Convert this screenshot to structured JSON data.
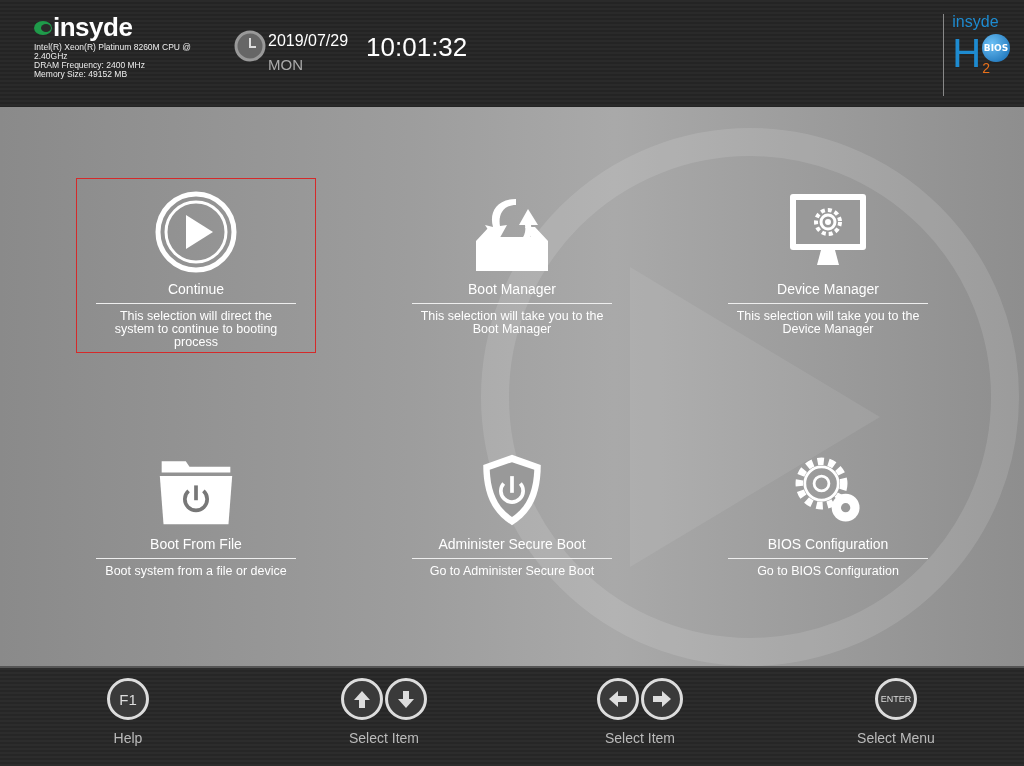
{
  "header": {
    "logo": {
      "brand": "insyde"
    },
    "system_info": [
      "Intel(R) Xeon(R) Platinum 8260M CPU @ 2.40GHz",
      "DRAM Frequency: 2400 MHz",
      "Memory Size: 49152 MB"
    ],
    "date": "2019/07/29",
    "day": "MON",
    "time": "10:01:32",
    "product_logo": {
      "brand": "insyde",
      "letter": "H",
      "sub": "2",
      "badge": "BIOS"
    }
  },
  "menu": [
    {
      "kind": "play",
      "title": "Continue",
      "description": "This selection will direct the system to continue to booting process",
      "selected": true
    },
    {
      "kind": "boot",
      "title": "Boot Manager",
      "description": "This selection will take you to the Boot Manager",
      "selected": false
    },
    {
      "kind": "device",
      "title": "Device Manager",
      "description": "This selection will take you to the Device Manager",
      "selected": false
    },
    {
      "kind": "file",
      "title": "Boot From File",
      "description": "Boot system from a file or device",
      "selected": false
    },
    {
      "kind": "secure",
      "title": "Administer Secure Boot",
      "description": "Go to Administer Secure Boot",
      "selected": false
    },
    {
      "kind": "config",
      "title": "BIOS Configuration",
      "description": "Go to BIOS Configuration",
      "selected": false
    }
  ],
  "footer": [
    {
      "keys": [
        {
          "kind": "label",
          "text": "F1"
        }
      ],
      "label": "Help"
    },
    {
      "keys": [
        {
          "kind": "up"
        },
        {
          "kind": "down"
        }
      ],
      "label": "Select Item"
    },
    {
      "keys": [
        {
          "kind": "left"
        },
        {
          "kind": "right"
        }
      ],
      "label": "Select Item"
    },
    {
      "keys": [
        {
          "kind": "label",
          "text": "ENTER"
        }
      ],
      "label": "Select Menu"
    }
  ]
}
